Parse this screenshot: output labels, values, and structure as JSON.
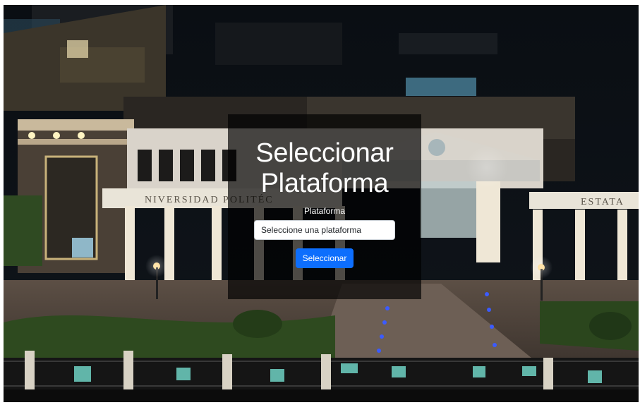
{
  "page": {
    "title": "Seleccionar Plataforma"
  },
  "form": {
    "label": "Plataforma",
    "select_value": "Seleccione una plataforma",
    "button_label": "Seleccionar"
  },
  "background": {
    "signs": [
      "NIVERSIDAD POLITÉC",
      "ESTATA"
    ]
  },
  "colors": {
    "accent": "#0d6efd",
    "overlay": "rgba(0,0,0,0.68)",
    "text": "#ffffff"
  }
}
